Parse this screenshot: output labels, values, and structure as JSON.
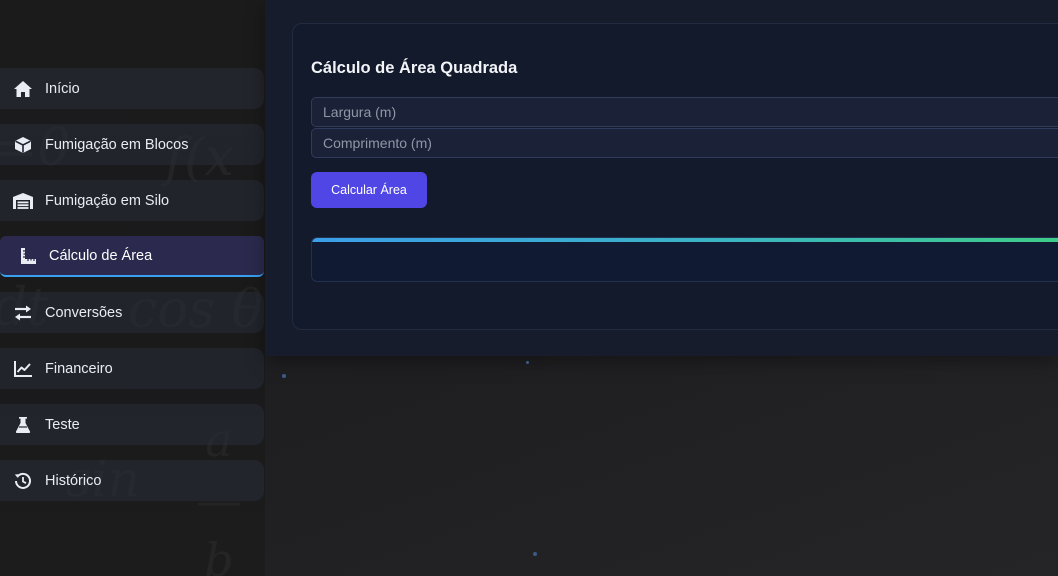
{
  "sidebar": {
    "items": [
      {
        "label": "Início",
        "icon": "home-icon"
      },
      {
        "label": "Fumigação em Blocos",
        "icon": "cube-icon"
      },
      {
        "label": "Fumigação em Silo",
        "icon": "warehouse-icon"
      },
      {
        "label": "Cálculo de Área",
        "icon": "ruler-icon",
        "active": true
      },
      {
        "label": "Conversões",
        "icon": "exchange-arrows-icon"
      },
      {
        "label": "Financeiro",
        "icon": "line-chart-icon"
      },
      {
        "label": "Teste",
        "icon": "flask-icon"
      },
      {
        "label": "Histórico",
        "icon": "history-icon"
      }
    ],
    "accent_color": "#3aa0f0"
  },
  "main": {
    "card_title": "Cálculo de Área Quadrada",
    "width_field": {
      "placeholder": "Largura (m)",
      "value": ""
    },
    "length_field": {
      "placeholder": "Comprimento (m)",
      "value": ""
    },
    "calculate_button": "Calcular Área",
    "result_text": ""
  },
  "colors": {
    "button": "#4f46e5",
    "result_bar_start": "#3b9ee8",
    "result_bar_end": "#3fcf83"
  }
}
